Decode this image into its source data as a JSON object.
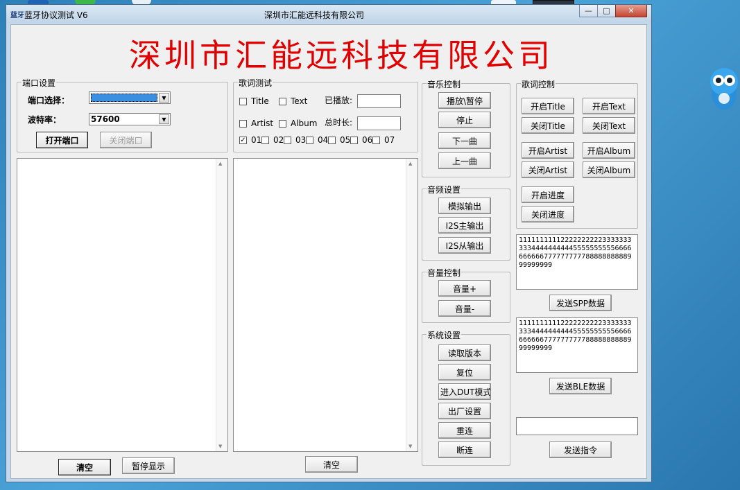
{
  "window": {
    "app_icon": "蓝牙",
    "title": "蓝牙协议测试 V6",
    "center_title": "深圳市汇能远科技有限公司",
    "buttons": {
      "minimize": "—",
      "maximize": "□",
      "close": "✕"
    }
  },
  "banner": "深圳市汇能远科技有限公司",
  "port_settings": {
    "legend": "端口设置",
    "port_label": "端口选择：",
    "baud_label": "波特率：",
    "baud_value": "57600",
    "open_button": "打开端口",
    "close_button": "关闭端口"
  },
  "lyrics_test": {
    "legend": "歌词测试",
    "checks": [
      {
        "label": "Title",
        "checked": false
      },
      {
        "label": "Text",
        "checked": false
      },
      {
        "label": "Artist",
        "checked": false
      },
      {
        "label": "Album",
        "checked": false
      }
    ],
    "played_label": "已播放:",
    "total_label": "总时长:",
    "numbers": [
      {
        "label": "01",
        "checked": true
      },
      {
        "label": "02",
        "checked": false
      },
      {
        "label": "03",
        "checked": false
      },
      {
        "label": "04",
        "checked": false
      },
      {
        "label": "05",
        "checked": false
      },
      {
        "label": "06",
        "checked": false
      },
      {
        "label": "07",
        "checked": false
      }
    ]
  },
  "bottom_left": {
    "clear": "清空",
    "pause": "暂停显示"
  },
  "bottom_mid": {
    "clear": "清空"
  },
  "music_control": {
    "legend": "音乐控制",
    "buttons": [
      "播放\\暂停",
      "停止",
      "下一曲",
      "上一曲"
    ]
  },
  "audio_settings": {
    "legend": "音频设置",
    "buttons": [
      "模拟输出",
      "I2S主输出",
      "I2S从输出"
    ]
  },
  "volume_control": {
    "legend": "音量控制",
    "buttons": [
      "音量+",
      "音量-"
    ]
  },
  "system_settings": {
    "legend": "系统设置",
    "buttons": [
      "读取版本",
      "复位",
      "进入DUT模式",
      "出厂设置",
      "重连",
      "断连"
    ]
  },
  "lyrics_control": {
    "legend": "歌词控制",
    "buttons": [
      "开启Title",
      "开启Text",
      "关闭Title",
      "关闭Text",
      "开启Artist",
      "开启Album",
      "关闭Artist",
      "关闭Album",
      "开启进度",
      "关闭进度"
    ]
  },
  "spp": {
    "text": "11111111112222222222333333333344444444445555555555666666666677777777778888888888999999999",
    "button": "发送SPP数据"
  },
  "ble": {
    "text": "11111111112222222222333333333344444444445555555555666666666677777777778888888888999999999",
    "button": "发送BLE数据"
  },
  "command": {
    "value": "",
    "button": "发送指令"
  },
  "colors": {
    "banner": "#e00000",
    "selection": "#3b8fe0",
    "titlebar": "#c5d8ea"
  }
}
